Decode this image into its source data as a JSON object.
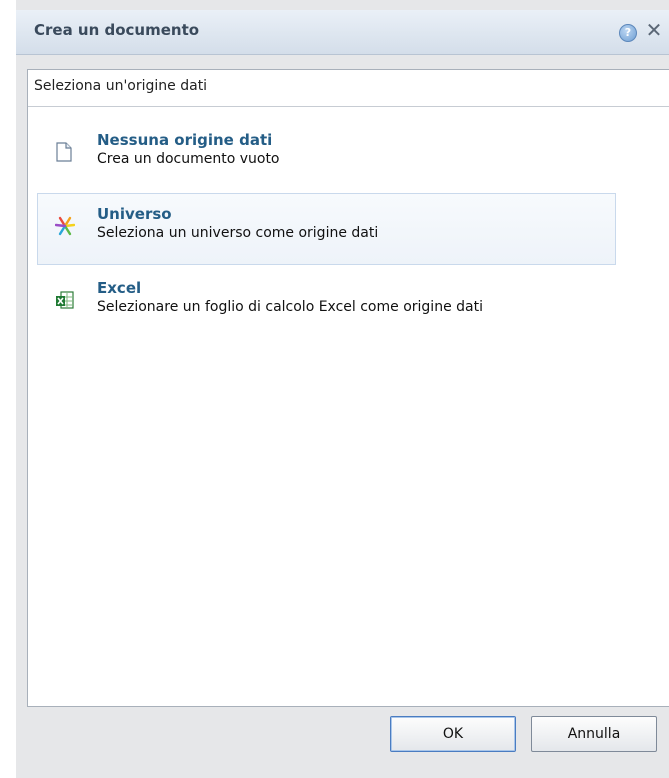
{
  "dialog": {
    "title": "Crea un documento",
    "help_label": "?",
    "close_label": "✕"
  },
  "panel": {
    "title": "Seleziona un'origine dati",
    "options": [
      {
        "label": "Nessuna origine dati",
        "description": "Crea un documento vuoto",
        "icon": "blank-document-icon",
        "selected": false
      },
      {
        "label": "Universo",
        "description": "Seleziona un universo come origine dati",
        "icon": "universe-icon",
        "selected": true
      },
      {
        "label": "Excel",
        "description": "Selezionare un foglio di calcolo Excel come origine dati",
        "icon": "excel-icon",
        "selected": false
      }
    ]
  },
  "buttons": {
    "ok_label": "OK",
    "cancel_label": "Annulla"
  },
  "colors": {
    "accent": "#245d86",
    "selection_border": "#c9d9ec",
    "titlebar": "#dce5f0"
  }
}
